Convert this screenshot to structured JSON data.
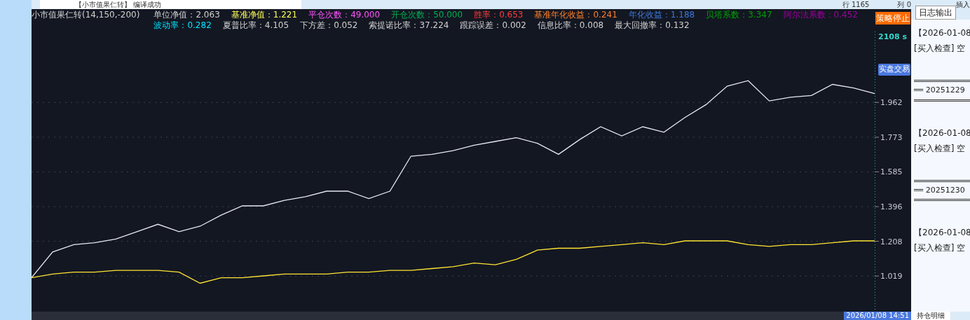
{
  "editor_status": {
    "message": "【小市值果仁转】 编译成功",
    "line": "行 1165",
    "column": "列 0",
    "mode": "插入"
  },
  "chart": {
    "title": "小市值果仁转(14,150,-200)",
    "metrics_row_1": [
      {
        "label": "单位净值：",
        "value": "2.063",
        "color": "#d0d0d0"
      },
      {
        "label": "基准净值：",
        "value": "1.221",
        "color": "#ffff55"
      },
      {
        "label": "平仓次数：",
        "value": "49.000",
        "color": "#ff55ff"
      },
      {
        "label": "开仓次数：",
        "value": "50.000",
        "color": "#00b050"
      },
      {
        "label": "胜率：",
        "value": "0.653",
        "color": "#ff3b3b"
      },
      {
        "label": "基准年化收益：",
        "value": "0.241",
        "color": "#ff7f27"
      },
      {
        "label": "年化收益：",
        "value": "1.188",
        "color": "#3c78d8"
      },
      {
        "label": "贝塔系数：",
        "value": "3.347",
        "color": "#00a000"
      },
      {
        "label": "阿尔法系数：",
        "value": "0.452",
        "color": "#a000a0"
      }
    ],
    "metrics_row_2": [
      {
        "label": "波动率：",
        "value": "0.282",
        "color": "#00e5ff"
      },
      {
        "label": "夏普比率：",
        "value": "4.105",
        "color": "#d0d0d0"
      },
      {
        "label": "下方差：",
        "value": "0.052",
        "color": "#d0d0d0"
      },
      {
        "label": "索提诺比率：",
        "value": "37.224",
        "color": "#d0d0d0"
      },
      {
        "label": "跟踪误差：",
        "value": "0.002",
        "color": "#d0d0d0"
      },
      {
        "label": "信息比率：",
        "value": "0.008",
        "color": "#d0d0d0"
      },
      {
        "label": "最大回撤率：",
        "value": "0.132",
        "color": "#d0d0d0"
      }
    ],
    "stop_badge": "策略停止",
    "elapsed": "2108 s",
    "mode_badge": "实盘交易",
    "chart_data": {
      "type": "line",
      "grid": true,
      "series": [
        {
          "color": "#e6e8f0",
          "values": [
            1.01,
            1.15,
            1.19,
            1.2,
            1.22,
            1.26,
            1.3,
            1.26,
            1.29,
            1.35,
            1.4,
            1.4,
            1.43,
            1.45,
            1.48,
            1.48,
            1.44,
            1.48,
            1.67,
            1.68,
            1.7,
            1.73,
            1.75,
            1.77,
            1.74,
            1.68,
            1.76,
            1.83,
            1.78,
            1.83,
            1.8,
            1.88,
            1.95,
            2.05,
            2.08,
            1.97,
            1.99,
            2.0,
            2.06,
            2.04,
            2.01
          ]
        },
        {
          "color": "#ffe533",
          "values": [
            1.01,
            1.03,
            1.04,
            1.04,
            1.05,
            1.05,
            1.05,
            1.04,
            0.98,
            1.01,
            1.01,
            1.02,
            1.03,
            1.03,
            1.03,
            1.04,
            1.04,
            1.05,
            1.05,
            1.06,
            1.07,
            1.09,
            1.08,
            1.11,
            1.16,
            1.17,
            1.17,
            1.18,
            1.19,
            1.2,
            1.19,
            1.21,
            1.21,
            1.21,
            1.19,
            1.18,
            1.19,
            1.19,
            1.2,
            1.21,
            1.21
          ]
        }
      ],
      "ylim": [
        0.826,
        2.347
      ],
      "yticks": [
        {
          "value": 1.962,
          "label": "1.962"
        },
        {
          "value": 1.773,
          "label": "1.773"
        },
        {
          "value": 1.585,
          "label": "1.585"
        },
        {
          "value": 1.396,
          "label": "1.396"
        },
        {
          "value": 1.208,
          "label": "1.208"
        },
        {
          "value": 1.019,
          "label": "1.019"
        }
      ]
    },
    "time_label": "2026/01/08 14:51"
  },
  "log_panel": {
    "tab": "日志输出",
    "entries": [
      {
        "kind": "entry",
        "date": "【2026-01-08",
        "text": "[买入检查] 空"
      },
      {
        "kind": "separator",
        "date": "══ 20251229"
      },
      {
        "kind": "entry",
        "date": "【2026-01-08",
        "text": "[买入检查] 空"
      },
      {
        "kind": "separator",
        "date": "══ 20251230"
      },
      {
        "kind": "entry",
        "date": "【2026-01-08",
        "text": "[买入检查] 空"
      }
    ],
    "bottom_tab": "持仓明细"
  }
}
